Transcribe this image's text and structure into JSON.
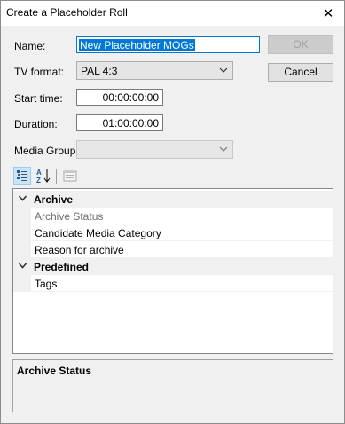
{
  "window": {
    "title": "Create a Placeholder Roll",
    "close_glyph": "✕"
  },
  "form": {
    "name_label": "Name:",
    "name_value": "New Placeholder MOGs",
    "tv_format_label": "TV format:",
    "tv_format_value": "PAL 4:3",
    "start_time_label": "Start time:",
    "start_time_value": "00:00:00:00",
    "duration_label": "Duration:",
    "duration_value": "01:00:00:00",
    "media_group_label": "Media Group:",
    "media_group_value": ""
  },
  "buttons": {
    "ok_label": "OK",
    "cancel_label": "Cancel"
  },
  "toolbar": {
    "icons": [
      "categorized-view-icon",
      "alphabetical-sort-icon",
      "property-pages-icon"
    ]
  },
  "property_grid": {
    "categories": [
      {
        "label": "Archive",
        "properties": [
          {
            "name": "Archive Status",
            "value": ""
          },
          {
            "name": "Candidate Media Category",
            "value": ""
          },
          {
            "name": "Reason for archive",
            "value": ""
          }
        ]
      },
      {
        "label": "Predefined",
        "properties": [
          {
            "name": "Tags",
            "value": ""
          }
        ]
      }
    ]
  },
  "help_panel": {
    "title": "Archive Status"
  },
  "colors": {
    "accent": "#0078d7",
    "dialog_bg": "#f0f0f0"
  }
}
